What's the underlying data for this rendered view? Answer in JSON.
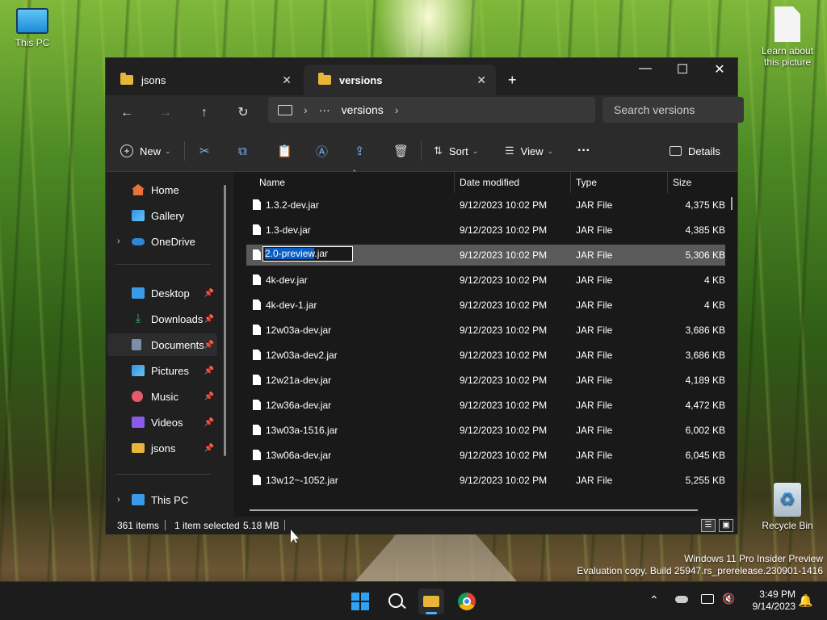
{
  "desktop": {
    "this_pc_label": "This PC",
    "learn_label_line1": "Learn about",
    "learn_label_line2": "this picture",
    "recycle_label": "Recycle Bin",
    "watermark_line1": "Windows 11 Pro Insider Preview",
    "watermark_line2": "Evaluation copy. Build 25947.rs_prerelease.230901-1416"
  },
  "explorer": {
    "tabs": [
      {
        "label": "jsons"
      },
      {
        "label": "versions"
      }
    ],
    "new_tab_glyph": "+",
    "window_controls": {
      "minimize": "—",
      "maximize": "☐",
      "close": "✕"
    },
    "address": {
      "ellipsis": "···",
      "crumb": "versions"
    },
    "search_placeholder": "Search versions",
    "toolbar": {
      "new_label": "New",
      "sort_label": "Sort",
      "view_label": "View",
      "more_label": "···",
      "details_label": "Details"
    },
    "sidebar": {
      "items": [
        {
          "label": "Home",
          "color": "#e8733a"
        },
        {
          "label": "Gallery",
          "color": "#3a8ee8"
        },
        {
          "label": "OneDrive",
          "color": "#2f86d8"
        },
        {
          "label": "Desktop",
          "color": "#3a9ae8"
        },
        {
          "label": "Downloads",
          "color": "#3ab86a"
        },
        {
          "label": "Documents",
          "color": "#7f8ea8"
        },
        {
          "label": "Pictures",
          "color": "#3a8ee8"
        },
        {
          "label": "Music",
          "color": "#e85a6a"
        },
        {
          "label": "Videos",
          "color": "#8a5ae8"
        },
        {
          "label": "jsons",
          "color": "#e8b53a"
        },
        {
          "label": "This PC",
          "color": "#3a9ae8"
        }
      ]
    },
    "columns": {
      "name": "Name",
      "date": "Date modified",
      "type": "Type",
      "size": "Size"
    },
    "files": [
      {
        "name": "1.3.2-dev.jar",
        "date": "9/12/2023 10:02 PM",
        "type": "JAR File",
        "size": "4,375 KB"
      },
      {
        "name": "1.3-dev.jar",
        "date": "9/12/2023 10:02 PM",
        "type": "JAR File",
        "size": "4,385 KB"
      },
      {
        "name": "2.0-preview.jar",
        "date": "9/12/2023 10:02 PM",
        "type": "JAR File",
        "size": "5,306 KB"
      },
      {
        "name": "4k-dev.jar",
        "date": "9/12/2023 10:02 PM",
        "type": "JAR File",
        "size": "4 KB"
      },
      {
        "name": "4k-dev-1.jar",
        "date": "9/12/2023 10:02 PM",
        "type": "JAR File",
        "size": "4 KB"
      },
      {
        "name": "12w03a-dev.jar",
        "date": "9/12/2023 10:02 PM",
        "type": "JAR File",
        "size": "3,686 KB"
      },
      {
        "name": "12w03a-dev2.jar",
        "date": "9/12/2023 10:02 PM",
        "type": "JAR File",
        "size": "3,686 KB"
      },
      {
        "name": "12w21a-dev.jar",
        "date": "9/12/2023 10:02 PM",
        "type": "JAR File",
        "size": "4,189 KB"
      },
      {
        "name": "12w36a-dev.jar",
        "date": "9/12/2023 10:02 PM",
        "type": "JAR File",
        "size": "4,472 KB"
      },
      {
        "name": "13w03a-1516.jar",
        "date": "9/12/2023 10:02 PM",
        "type": "JAR File",
        "size": "6,002 KB"
      },
      {
        "name": "13w06a-dev.jar",
        "date": "9/12/2023 10:02 PM",
        "type": "JAR File",
        "size": "6,045 KB"
      },
      {
        "name": "13w12~-1052.jar",
        "date": "9/12/2023 10:02 PM",
        "type": "JAR File",
        "size": "5,255 KB"
      }
    ],
    "rename": {
      "selected_part": "2.0-preview",
      "rest": ".jar"
    },
    "status": {
      "items_count": "361 items",
      "selection": "1 item selected",
      "size": "5.18 MB"
    }
  },
  "taskbar": {
    "time": "3:49 PM",
    "date": "9/14/2023"
  }
}
